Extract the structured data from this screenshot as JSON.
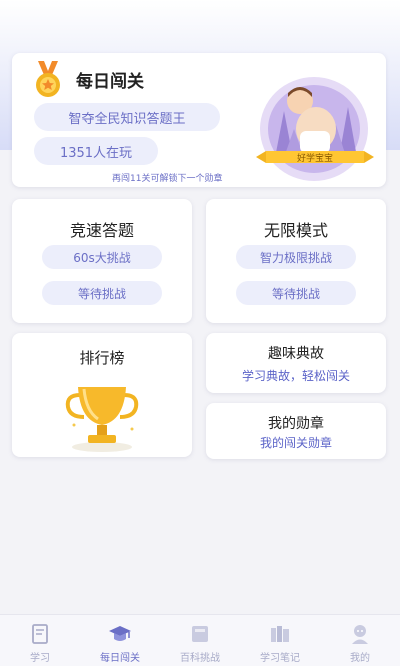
{
  "daily": {
    "title": "每日闯关",
    "pill_title": "智夺全民知识答题王",
    "pill_players": "1351人在玩",
    "hint": "再闯11关可解锁下一个勋章",
    "banner_text": "好学宝宝"
  },
  "speed": {
    "title": "竞速答题",
    "pill1": "60s大挑战",
    "pill2": "等待挑战"
  },
  "infinite": {
    "title": "无限模式",
    "pill1": "智力极限挑战",
    "pill2": "等待挑战"
  },
  "rank": {
    "title": "排行榜"
  },
  "story": {
    "title": "趣味典故",
    "sub": "学习典故，轻松闯关"
  },
  "medal": {
    "title": "我的勋章",
    "sub": "我的闯关勋章"
  },
  "nav": {
    "items": [
      {
        "label": "学习",
        "icon": "book-icon"
      },
      {
        "label": "每日闯关",
        "icon": "graduation-cap-icon"
      },
      {
        "label": "百科挑战",
        "icon": "encyclopedia-icon"
      },
      {
        "label": "学习笔记",
        "icon": "books-shelf-icon"
      },
      {
        "label": "我的",
        "icon": "profile-icon"
      }
    ],
    "active_index": 1
  },
  "colors": {
    "accent": "#6b6fc6",
    "pill_bg": "#eceefb",
    "gold": "#f2b422"
  }
}
